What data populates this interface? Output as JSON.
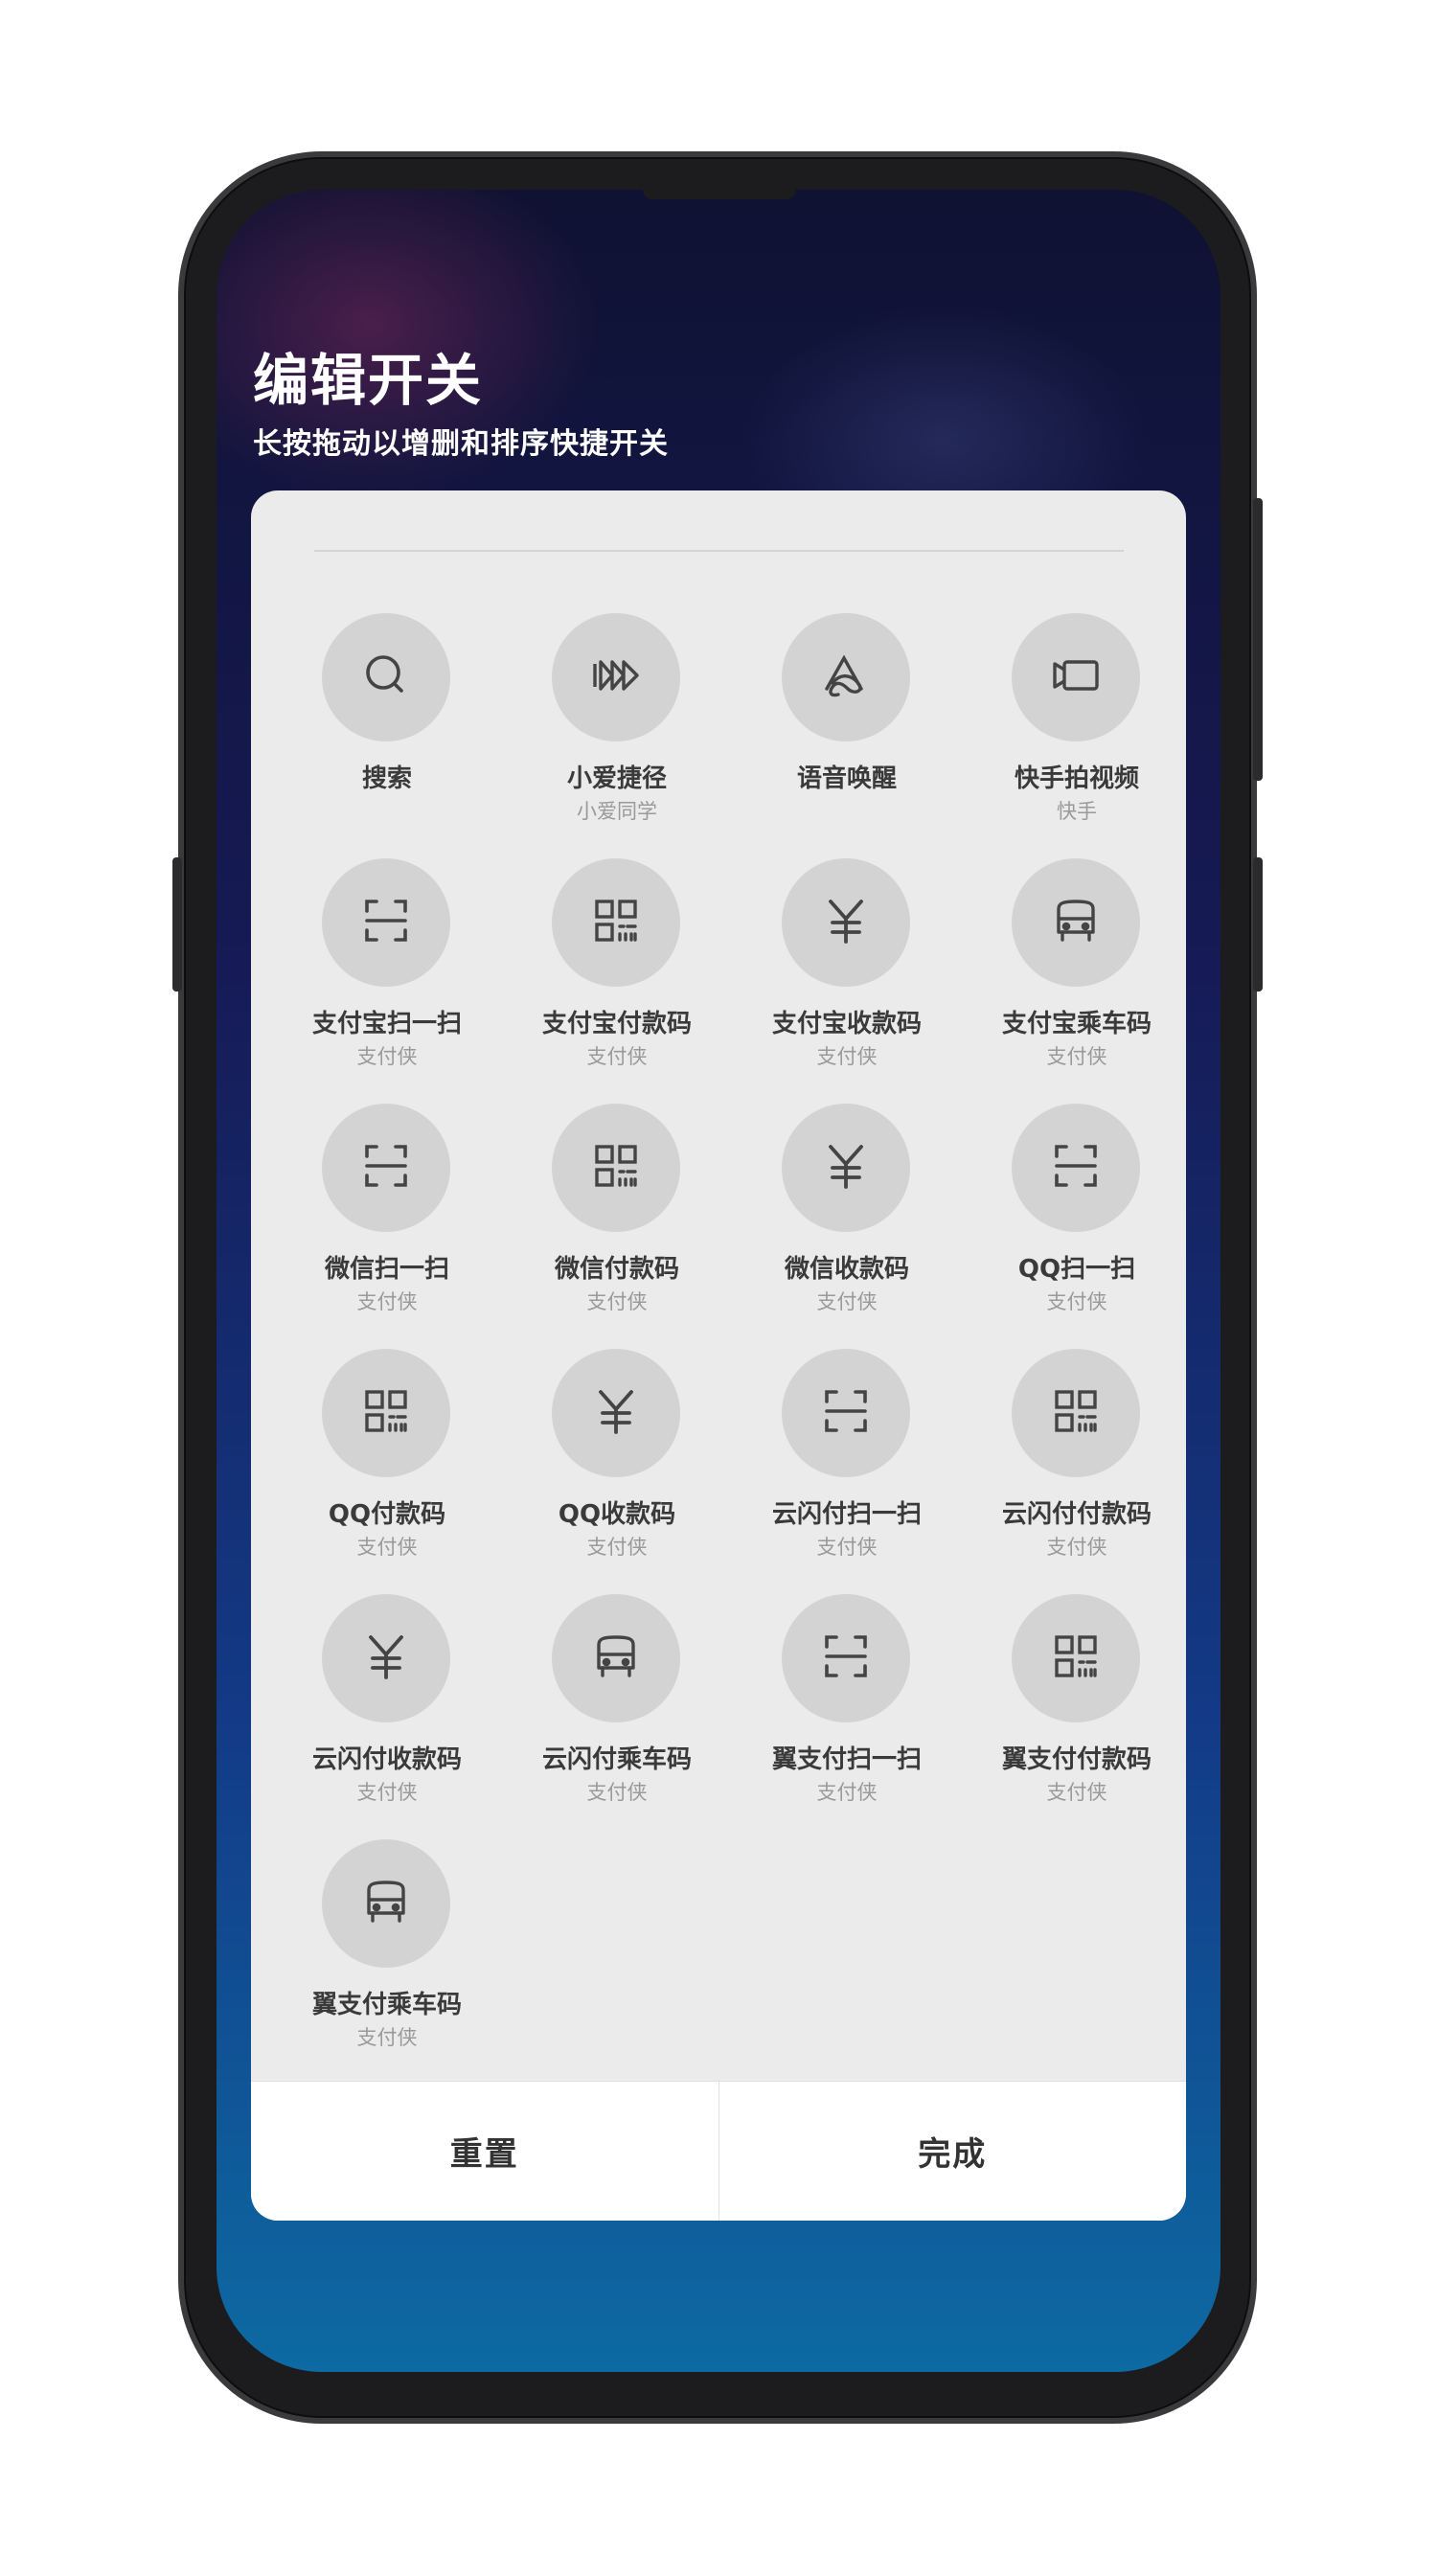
{
  "header": {
    "title": "编辑开关",
    "subtitle": "长按拖动以增删和排序快捷开关"
  },
  "tiles": [
    {
      "label": "搜索",
      "sub": "",
      "icon": "search-icon"
    },
    {
      "label": "小爱捷径",
      "sub": "小爱同学",
      "icon": "fast-forward-icon"
    },
    {
      "label": "语音唤醒",
      "sub": "",
      "icon": "voice-wake-icon"
    },
    {
      "label": "快手拍视频",
      "sub": "快手",
      "icon": "video-camera-icon"
    },
    {
      "label": "支付宝扫一扫",
      "sub": "支付侠",
      "icon": "scan-icon"
    },
    {
      "label": "支付宝付款码",
      "sub": "支付侠",
      "icon": "qr-code-icon"
    },
    {
      "label": "支付宝收款码",
      "sub": "支付侠",
      "icon": "yuan-icon"
    },
    {
      "label": "支付宝乘车码",
      "sub": "支付侠",
      "icon": "bus-icon"
    },
    {
      "label": "微信扫一扫",
      "sub": "支付侠",
      "icon": "scan-icon"
    },
    {
      "label": "微信付款码",
      "sub": "支付侠",
      "icon": "qr-code-icon"
    },
    {
      "label": "微信收款码",
      "sub": "支付侠",
      "icon": "yuan-icon"
    },
    {
      "label": "QQ扫一扫",
      "sub": "支付侠",
      "icon": "scan-icon"
    },
    {
      "label": "QQ付款码",
      "sub": "支付侠",
      "icon": "qr-code-icon"
    },
    {
      "label": "QQ收款码",
      "sub": "支付侠",
      "icon": "yuan-icon"
    },
    {
      "label": "云闪付扫一扫",
      "sub": "支付侠",
      "icon": "scan-icon"
    },
    {
      "label": "云闪付付款码",
      "sub": "支付侠",
      "icon": "qr-code-icon"
    },
    {
      "label": "云闪付收款码",
      "sub": "支付侠",
      "icon": "yuan-icon"
    },
    {
      "label": "云闪付乘车码",
      "sub": "支付侠",
      "icon": "bus-icon"
    },
    {
      "label": "翼支付扫一扫",
      "sub": "支付侠",
      "icon": "scan-icon"
    },
    {
      "label": "翼支付付款码",
      "sub": "支付侠",
      "icon": "qr-code-icon"
    },
    {
      "label": "翼支付乘车码",
      "sub": "支付侠",
      "icon": "bus-icon"
    }
  ],
  "footer": {
    "reset_label": "重置",
    "done_label": "完成"
  }
}
